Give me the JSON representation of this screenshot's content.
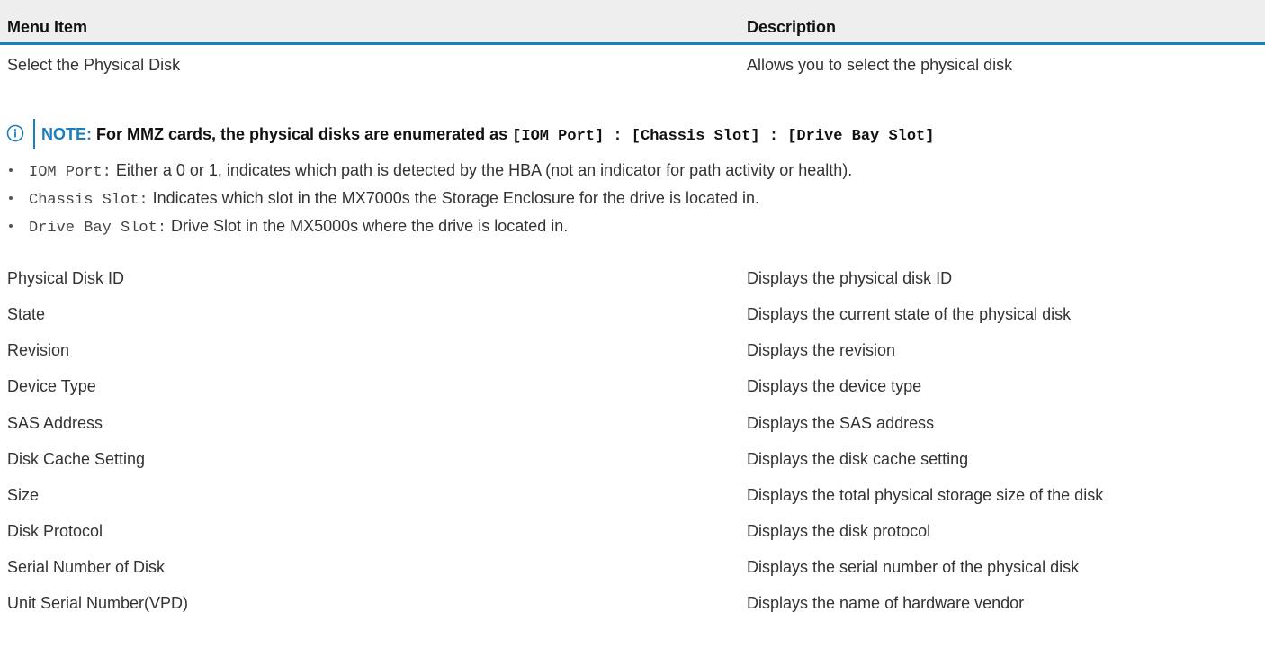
{
  "table": {
    "header": {
      "menu_item": "Menu Item",
      "description": "Description"
    },
    "first_row": {
      "item": "Select the Physical Disk",
      "description": "Allows you to select the physical disk"
    },
    "rows": [
      {
        "item": "Physical Disk ID",
        "description": "Displays the physical disk ID"
      },
      {
        "item": "State",
        "description": "Displays the current state of the physical disk"
      },
      {
        "item": "Revision",
        "description": "Displays the revision"
      },
      {
        "item": "Device Type",
        "description": "Displays the device type"
      },
      {
        "item": "SAS Address",
        "description": "Displays the SAS address"
      },
      {
        "item": "Disk Cache Setting",
        "description": "Displays the disk cache setting"
      },
      {
        "item": "Size",
        "description": "Displays the total physical storage size of the disk"
      },
      {
        "item": "Disk Protocol",
        "description": "Displays the disk protocol"
      },
      {
        "item": "Serial Number of Disk",
        "description": "Displays the serial number of the physical disk"
      },
      {
        "item": "Unit Serial Number(VPD)",
        "description": "Displays the name of hardware vendor"
      }
    ]
  },
  "note": {
    "icon": "info-icon",
    "label": "NOTE:",
    "text": " For MMZ cards, the physical disks are enumerated as ",
    "code": "[IOM Port] : [Chassis Slot] : [Drive Bay Slot]"
  },
  "bullets": [
    {
      "term": "IOM Port",
      "sep": ":",
      "text": " Either a 0 or 1, indicates which path is detected by the HBA (not an indicator for path activity or health)."
    },
    {
      "term": "Chassis Slot",
      "sep": ":",
      "text": " Indicates which slot in the MX7000s the Storage Enclosure for the drive is located in."
    },
    {
      "term": "Drive Bay Slot",
      "sep": ":",
      "text": " Drive Slot in the MX5000s where the drive is located in."
    }
  ],
  "colors": {
    "accent": "#1a7fbd",
    "header_bg": "#eeeeee"
  }
}
